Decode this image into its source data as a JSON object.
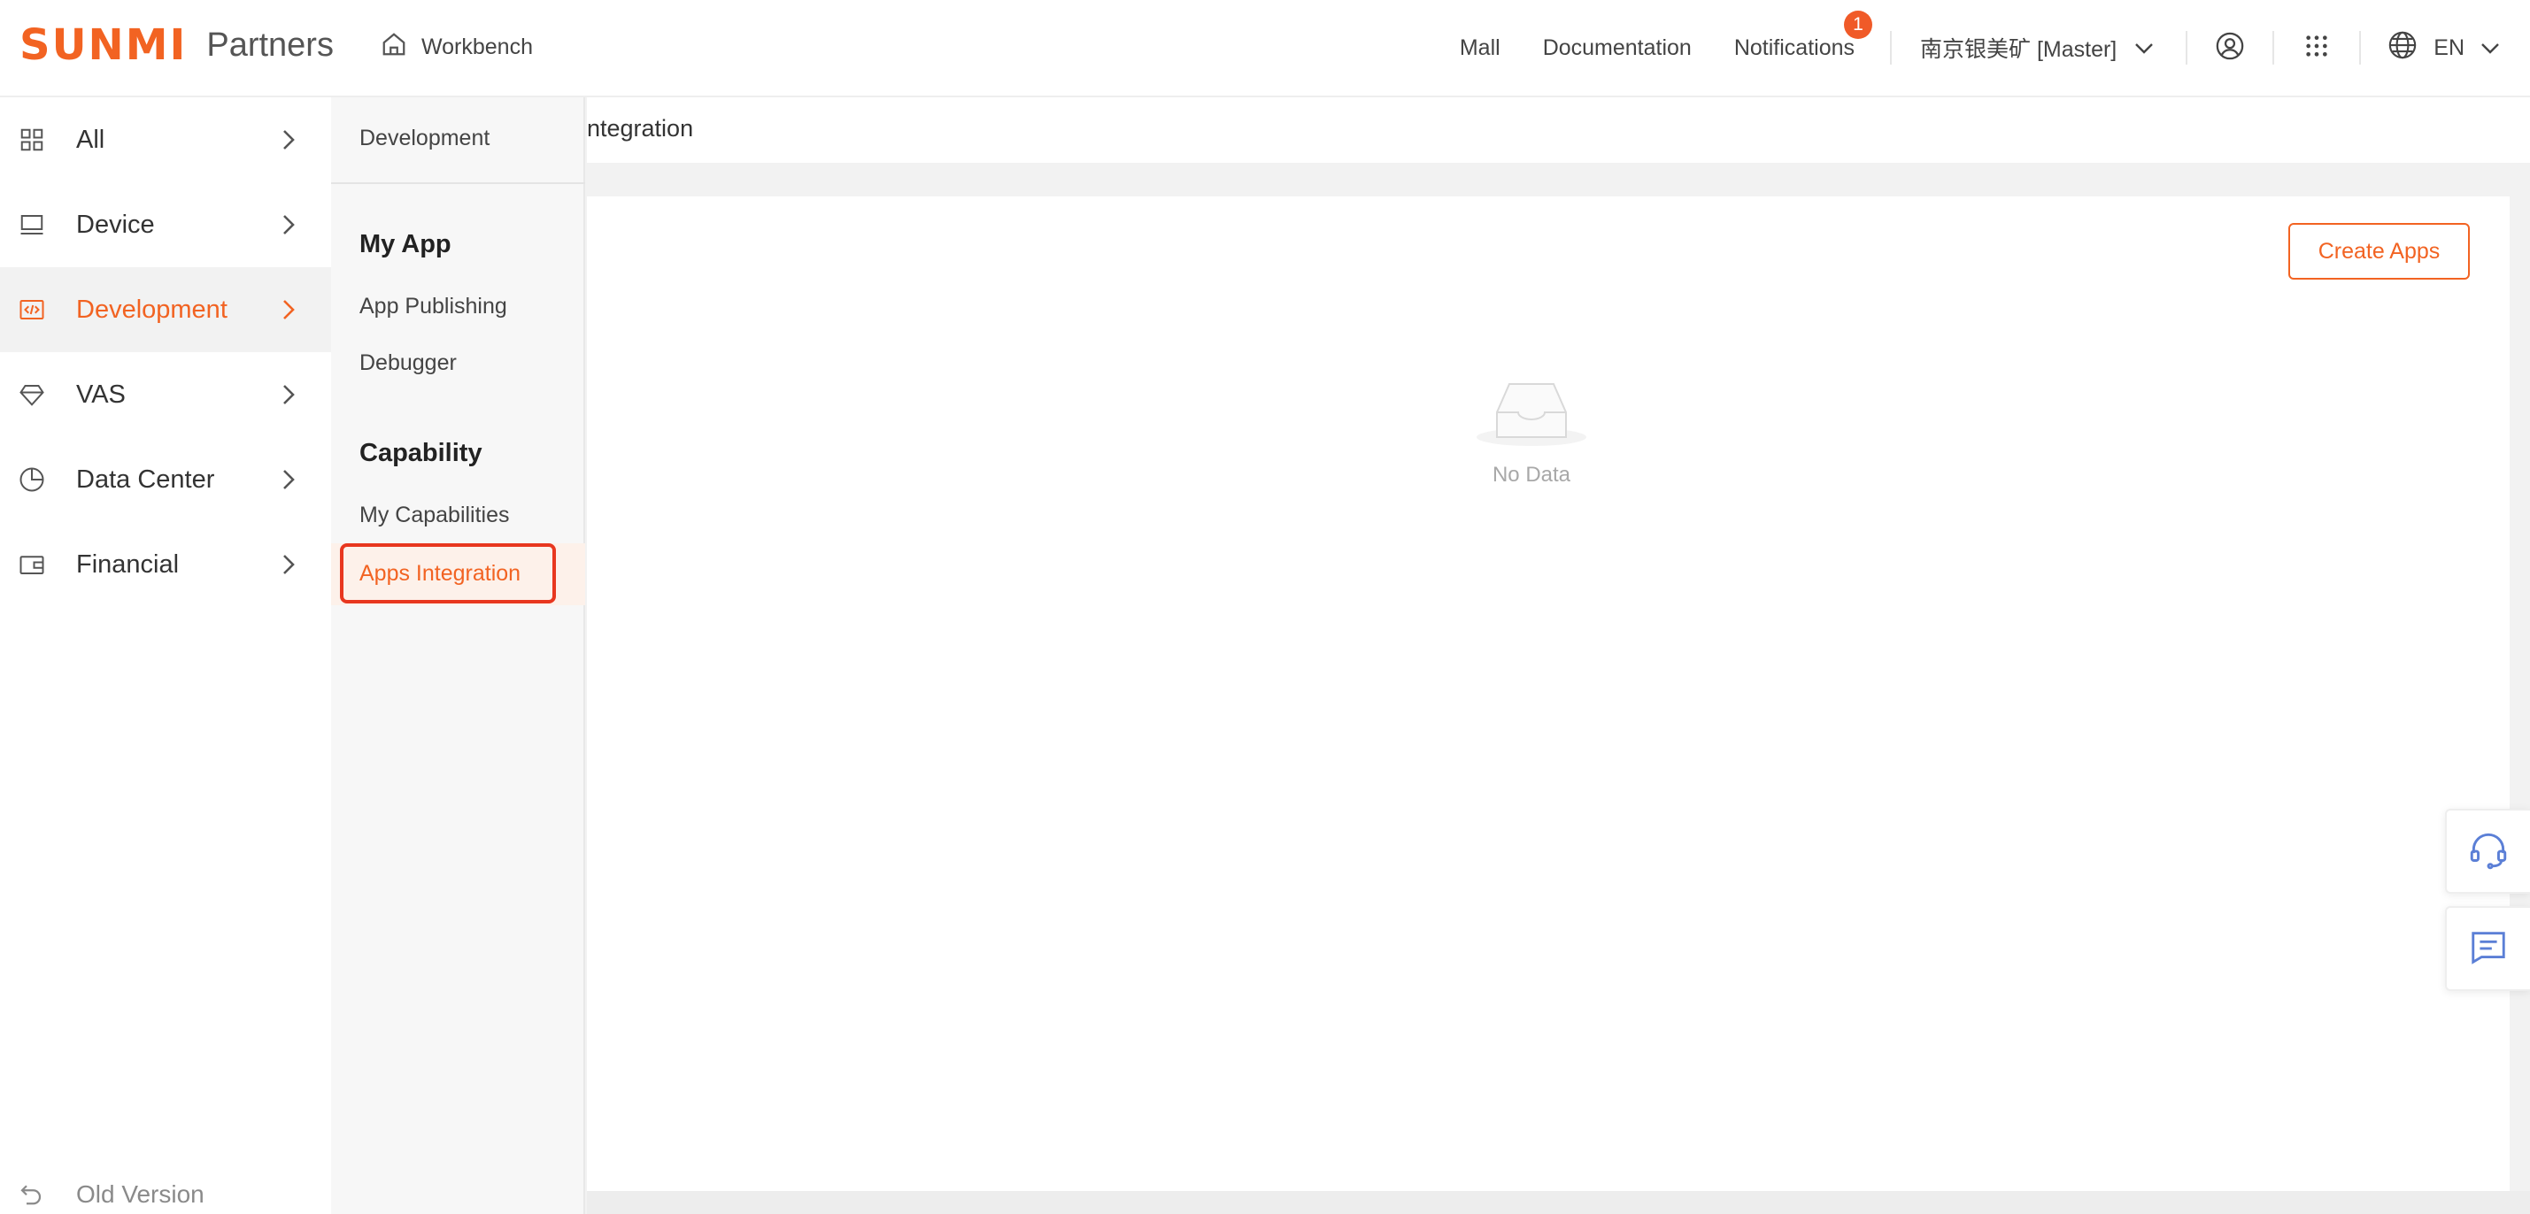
{
  "brand": {
    "logo": "SUNMI",
    "subtitle": "Partners",
    "accent": "#f26322"
  },
  "header": {
    "workbench": "Workbench",
    "links": {
      "mall": "Mall",
      "documentation": "Documentation",
      "notifications": "Notifications"
    },
    "notification_count": "1",
    "account": "南京银美矿 [Master]",
    "language": "EN"
  },
  "sidebar": {
    "items": [
      {
        "label": "All",
        "icon": "grid-icon"
      },
      {
        "label": "Device",
        "icon": "monitor-icon"
      },
      {
        "label": "Development",
        "icon": "code-icon",
        "active": true
      },
      {
        "label": "VAS",
        "icon": "diamond-icon"
      },
      {
        "label": "Data Center",
        "icon": "pie-chart-icon"
      },
      {
        "label": "Financial",
        "icon": "wallet-icon"
      }
    ],
    "old_version": "Old Version"
  },
  "submenu": {
    "title": "Development",
    "groups": [
      {
        "heading": "My App",
        "items": [
          "App Publishing",
          "Debugger"
        ]
      },
      {
        "heading": "Capability",
        "items": [
          "My Capabilities",
          "Apps Integration"
        ]
      }
    ],
    "active_item": "Apps Integration"
  },
  "main": {
    "breadcrumb": "ntegration",
    "create_button": "Create Apps",
    "empty_text": "No Data"
  },
  "floating": {
    "support": "headset-icon",
    "feedback": "message-icon"
  }
}
